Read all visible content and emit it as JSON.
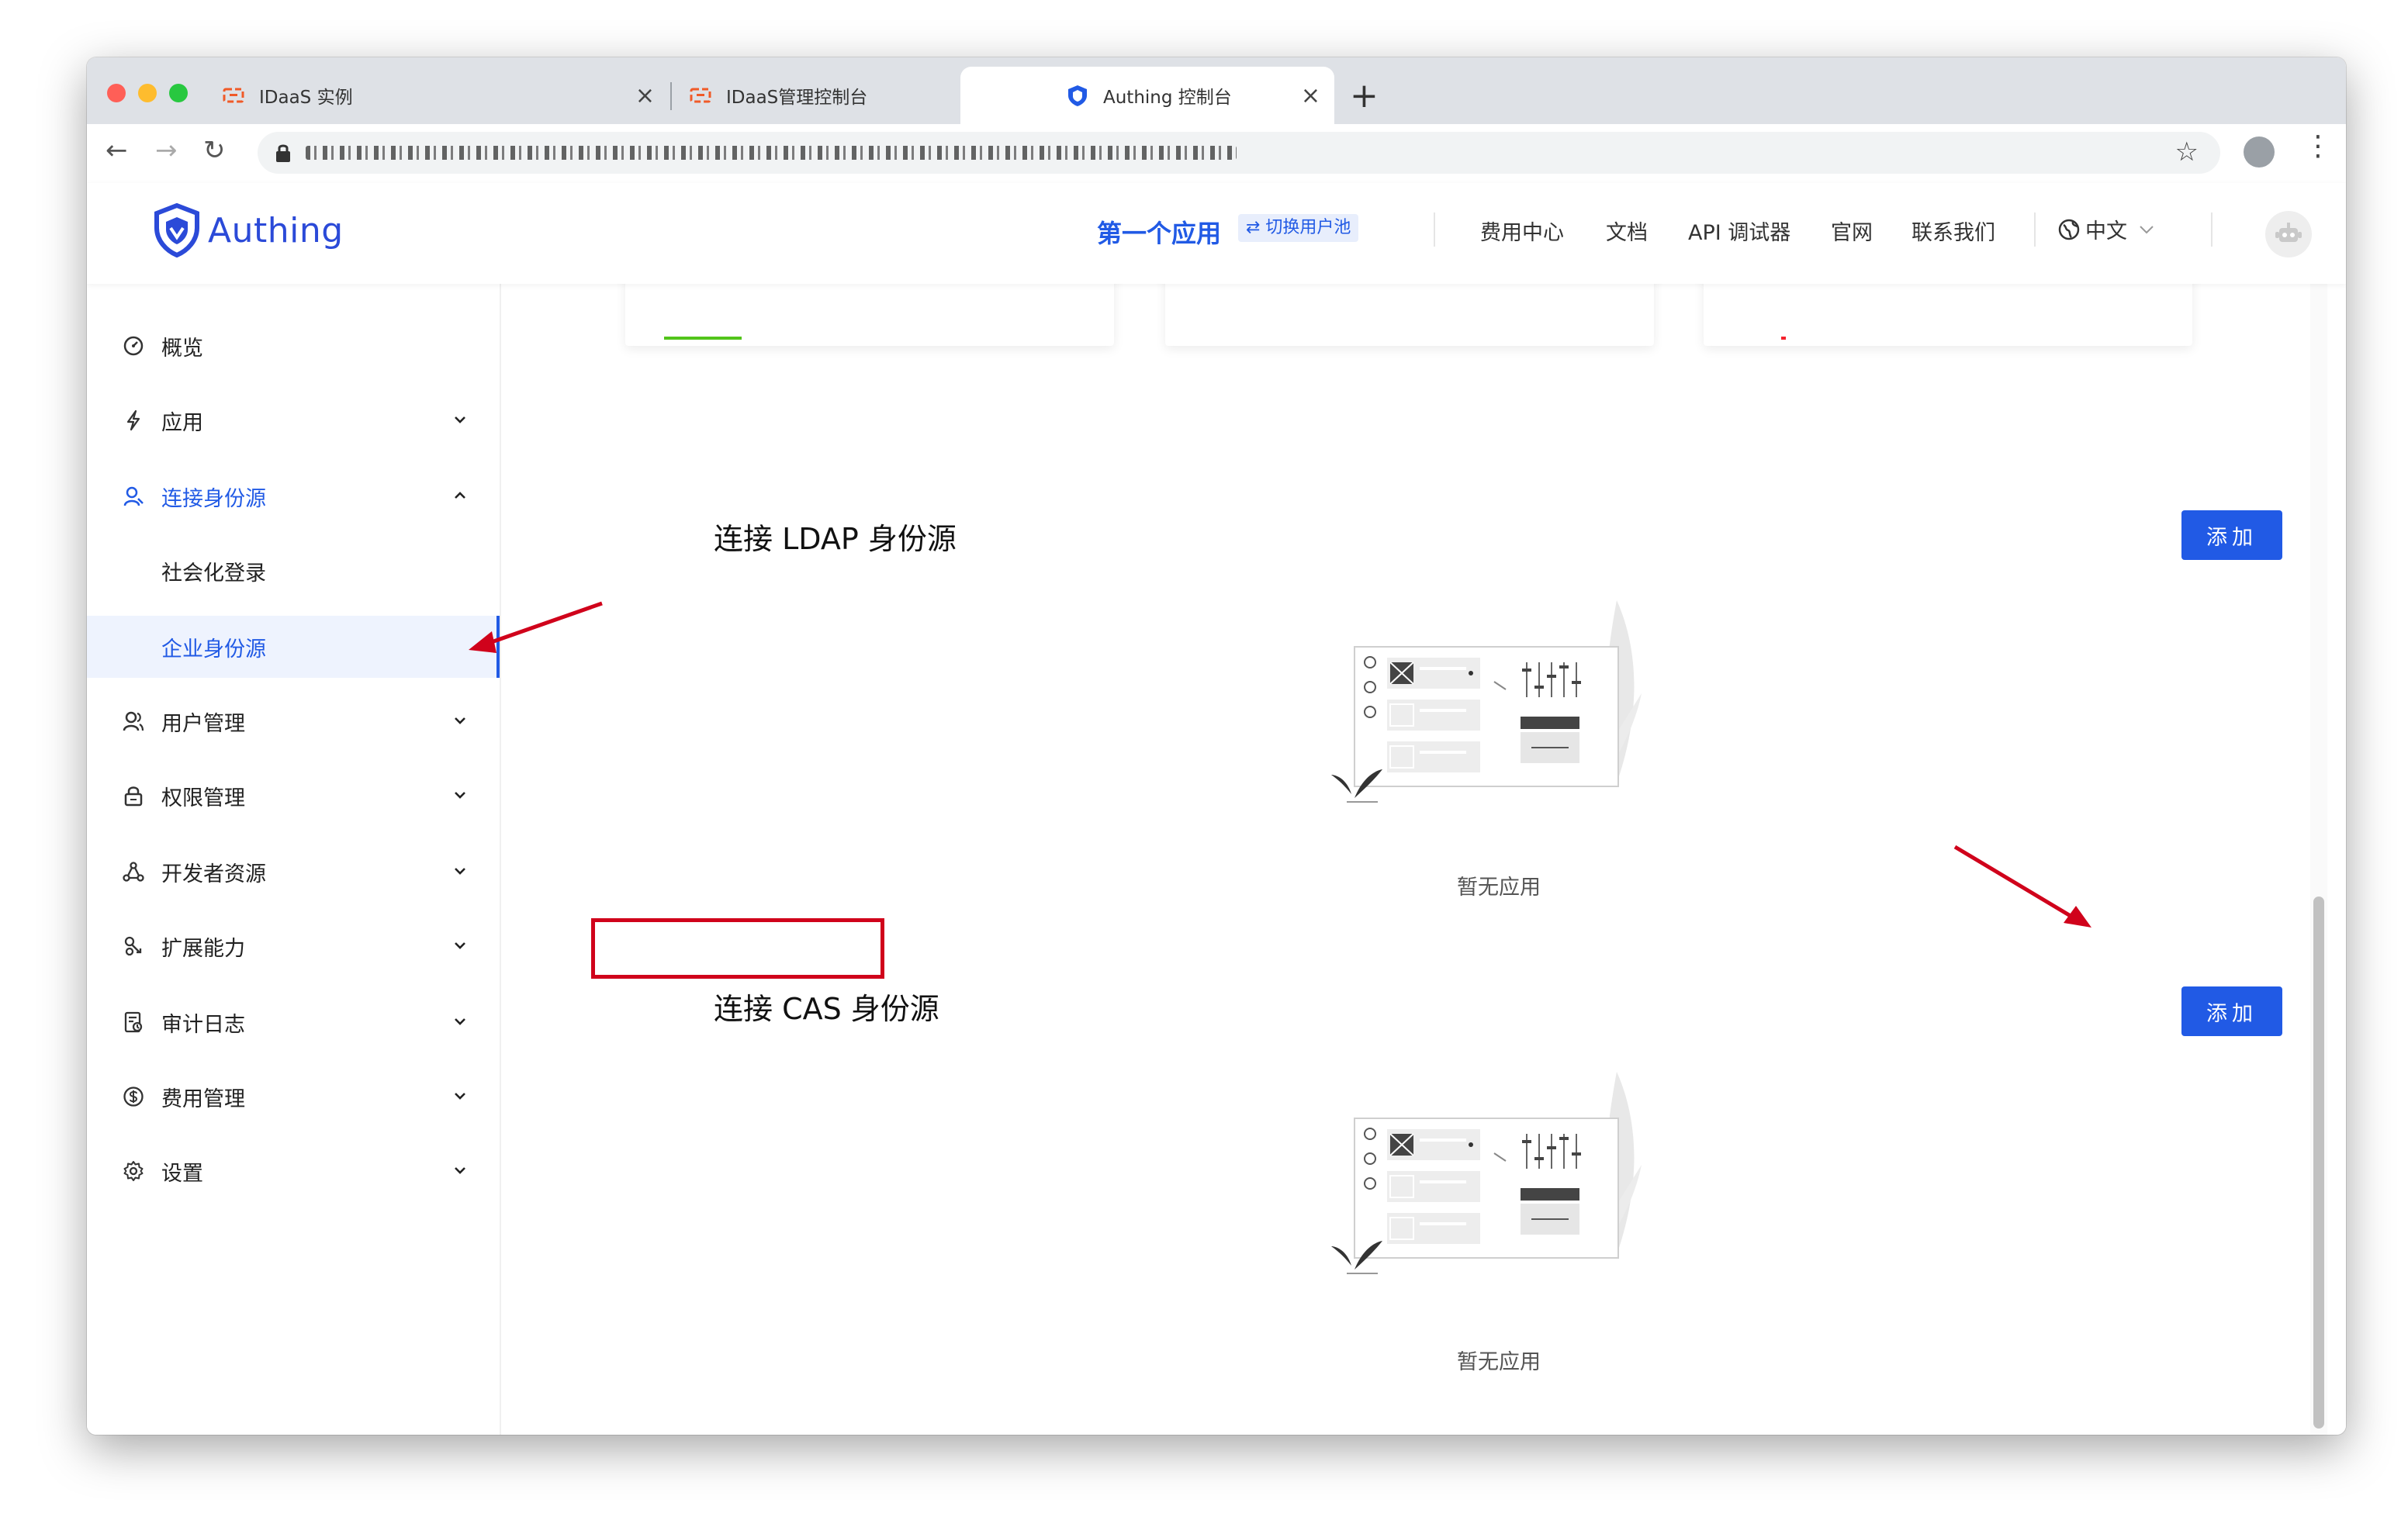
{
  "browser": {
    "tabs": [
      {
        "label": "IDaaS 实例",
        "active": false
      },
      {
        "label": "IDaaS管理控制台",
        "active": false
      },
      {
        "label": "Authing 控制台",
        "active": true
      }
    ],
    "new_tab": "+"
  },
  "header": {
    "logo_text": "Authing",
    "app_name": "第一个应用",
    "switch_pool": "⇄ 切换用户池",
    "nav": [
      "费用中心",
      "文档",
      "API 调试器",
      "官网",
      "联系我们"
    ],
    "language": "中文"
  },
  "sidebar": {
    "items": [
      {
        "label": "概览",
        "icon": "dashboard-icon",
        "expandable": false
      },
      {
        "label": "应用",
        "icon": "lightning-icon",
        "expandable": true
      },
      {
        "label": "连接身份源",
        "icon": "user-link-icon",
        "expandable": true,
        "expanded": true
      },
      {
        "label": "社会化登录",
        "sub": true
      },
      {
        "label": "企业身份源",
        "sub": true,
        "selected": true
      },
      {
        "label": "用户管理",
        "icon": "users-icon",
        "expandable": true
      },
      {
        "label": "权限管理",
        "icon": "lock-icon",
        "expandable": true
      },
      {
        "label": "开发者资源",
        "icon": "nodes-icon",
        "expandable": true
      },
      {
        "label": "扩展能力",
        "icon": "extension-icon",
        "expandable": true
      },
      {
        "label": "审计日志",
        "icon": "log-icon",
        "expandable": true
      },
      {
        "label": "费用管理",
        "icon": "dollar-icon",
        "expandable": true
      },
      {
        "label": "设置",
        "icon": "gear-icon",
        "expandable": true
      }
    ]
  },
  "content": {
    "sections": [
      {
        "title": "连接 LDAP 身份源",
        "add_label": "添加",
        "empty_text": "暂无应用"
      },
      {
        "title": "连接 CAS 身份源",
        "add_label": "添加",
        "empty_text": "暂无应用"
      }
    ]
  },
  "colors": {
    "primary": "#215ae5",
    "annotation": "#d0021b"
  }
}
